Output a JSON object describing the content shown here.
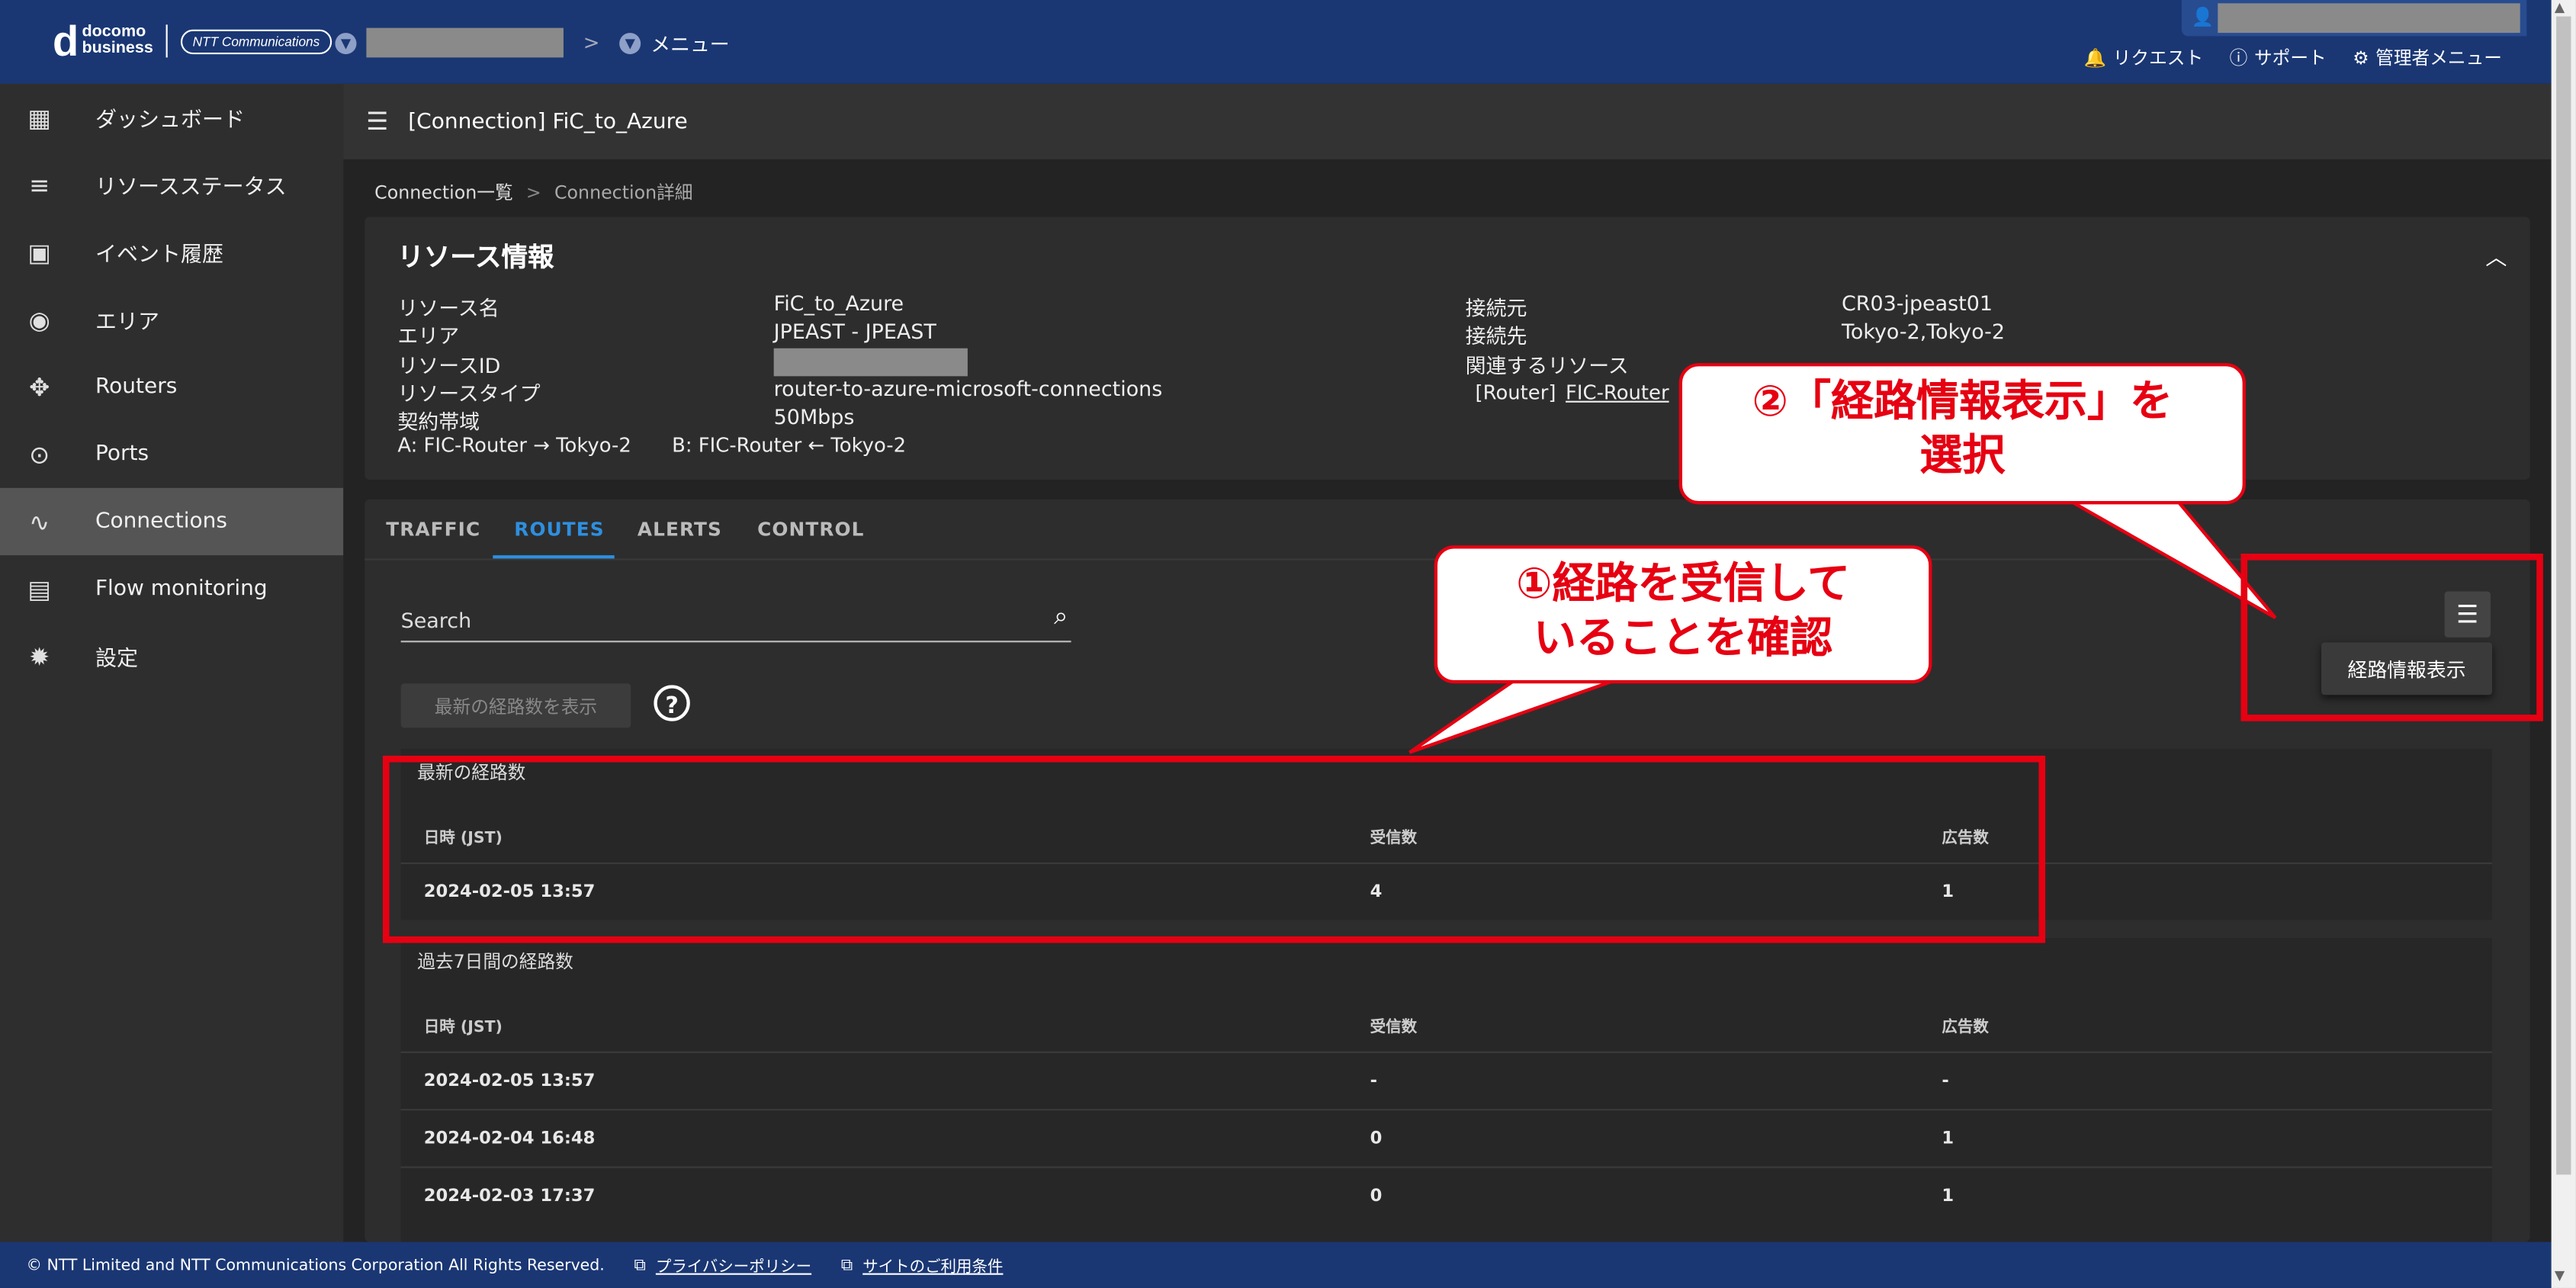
{
  "header": {
    "logo_d": "d",
    "logo_line1": "docomo",
    "logo_line2": "business",
    "ntt_logo": "NTT Communications",
    "menu_label": "メニュー",
    "links": [
      {
        "icon": "bell-icon",
        "label": "リクエスト"
      },
      {
        "icon": "help-icon",
        "label": "サポート"
      },
      {
        "icon": "gear-icon",
        "label": "管理者メニュー"
      }
    ]
  },
  "sidebar": {
    "items": [
      {
        "name": "dashboard",
        "icon": "grid-icon",
        "glyph": "▦",
        "label": "ダッシュボード"
      },
      {
        "name": "resource-status",
        "icon": "checklist-icon",
        "glyph": "≡",
        "label": "リソースステータス"
      },
      {
        "name": "event-history",
        "icon": "calendar-icon",
        "glyph": "▣",
        "label": "イベント履歴"
      },
      {
        "name": "area",
        "icon": "globe-icon",
        "glyph": "◉",
        "label": "エリア"
      },
      {
        "name": "routers",
        "icon": "router-icon",
        "glyph": "✥",
        "label": "Routers"
      },
      {
        "name": "ports",
        "icon": "toggle-icon",
        "glyph": "⊙",
        "label": "Ports"
      },
      {
        "name": "connections",
        "icon": "route-icon",
        "glyph": "∿",
        "label": "Connections"
      },
      {
        "name": "flow-monitoring",
        "icon": "document-icon",
        "glyph": "▤",
        "label": "Flow monitoring"
      },
      {
        "name": "settings",
        "icon": "gear-icon",
        "glyph": "✹",
        "label": "設定"
      }
    ],
    "active": "Connections"
  },
  "title_bar": {
    "title": "[Connection] FiC_to_Azure"
  },
  "breadcrumb": {
    "parent": "Connection一覧",
    "separator": ">",
    "current": "Connection詳細"
  },
  "resource_info": {
    "title": "リソース情報",
    "left": [
      {
        "k": "リソース名",
        "v": "FiC_to_Azure"
      },
      {
        "k": "エリア",
        "v": "JPEAST - JPEAST"
      },
      {
        "k": "リソースID",
        "v": ""
      },
      {
        "k": "リソースタイプ",
        "v": "router-to-azure-microsoft-connections"
      },
      {
        "k": "契約帯域",
        "v": "50Mbps"
      }
    ],
    "direction_a": "A: FIC-Router → Tokyo-2",
    "direction_b": "B: FIC-Router ← Tokyo-2",
    "right": [
      {
        "k": "接続元",
        "v": "CR03-jpeast01"
      },
      {
        "k": "接続先",
        "v": "Tokyo-2,Tokyo-2"
      },
      {
        "k": "関連するリソース",
        "v": ""
      }
    ],
    "related_type": "[Router]",
    "related_link": "FIC-Router"
  },
  "tabs": [
    "TRAFFIC",
    "ROUTES",
    "ALERTS",
    "CONTROL"
  ],
  "active_tab": "ROUTES",
  "search": {
    "label": "Search"
  },
  "latest_button": "最新の経路数を表示",
  "help_glyph": "?",
  "menu_popup": "経路情報表示",
  "latest_table": {
    "caption": "最新の経路数",
    "headers": [
      "日時 (JST)",
      "受信数",
      "広告数"
    ],
    "rows": [
      [
        "2024-02-05 13:57",
        "4",
        "1"
      ]
    ]
  },
  "week_table": {
    "caption": "過去7日間の経路数",
    "headers": [
      "日時 (JST)",
      "受信数",
      "広告数"
    ],
    "rows": [
      [
        "2024-02-05 13:57",
        "-",
        "-"
      ],
      [
        "2024-02-04 16:48",
        "0",
        "1"
      ],
      [
        "2024-02-03 17:37",
        "0",
        "1"
      ]
    ]
  },
  "footer": {
    "copyright": "© NTT Limited and NTT Communications Corporation All Rights Reserved.",
    "privacy": "プライバシーポリシー",
    "terms": "サイトのご利用条件"
  },
  "annotations": {
    "callout1_line1": "①経路を受信して",
    "callout1_line2": "いることを確認",
    "callout2_line1": "②「経路情報表示」を",
    "callout2_line2": "選択"
  },
  "colors": {
    "header": "#1a3774",
    "accent": "#2e8fe0",
    "annotation": "#e60012"
  }
}
